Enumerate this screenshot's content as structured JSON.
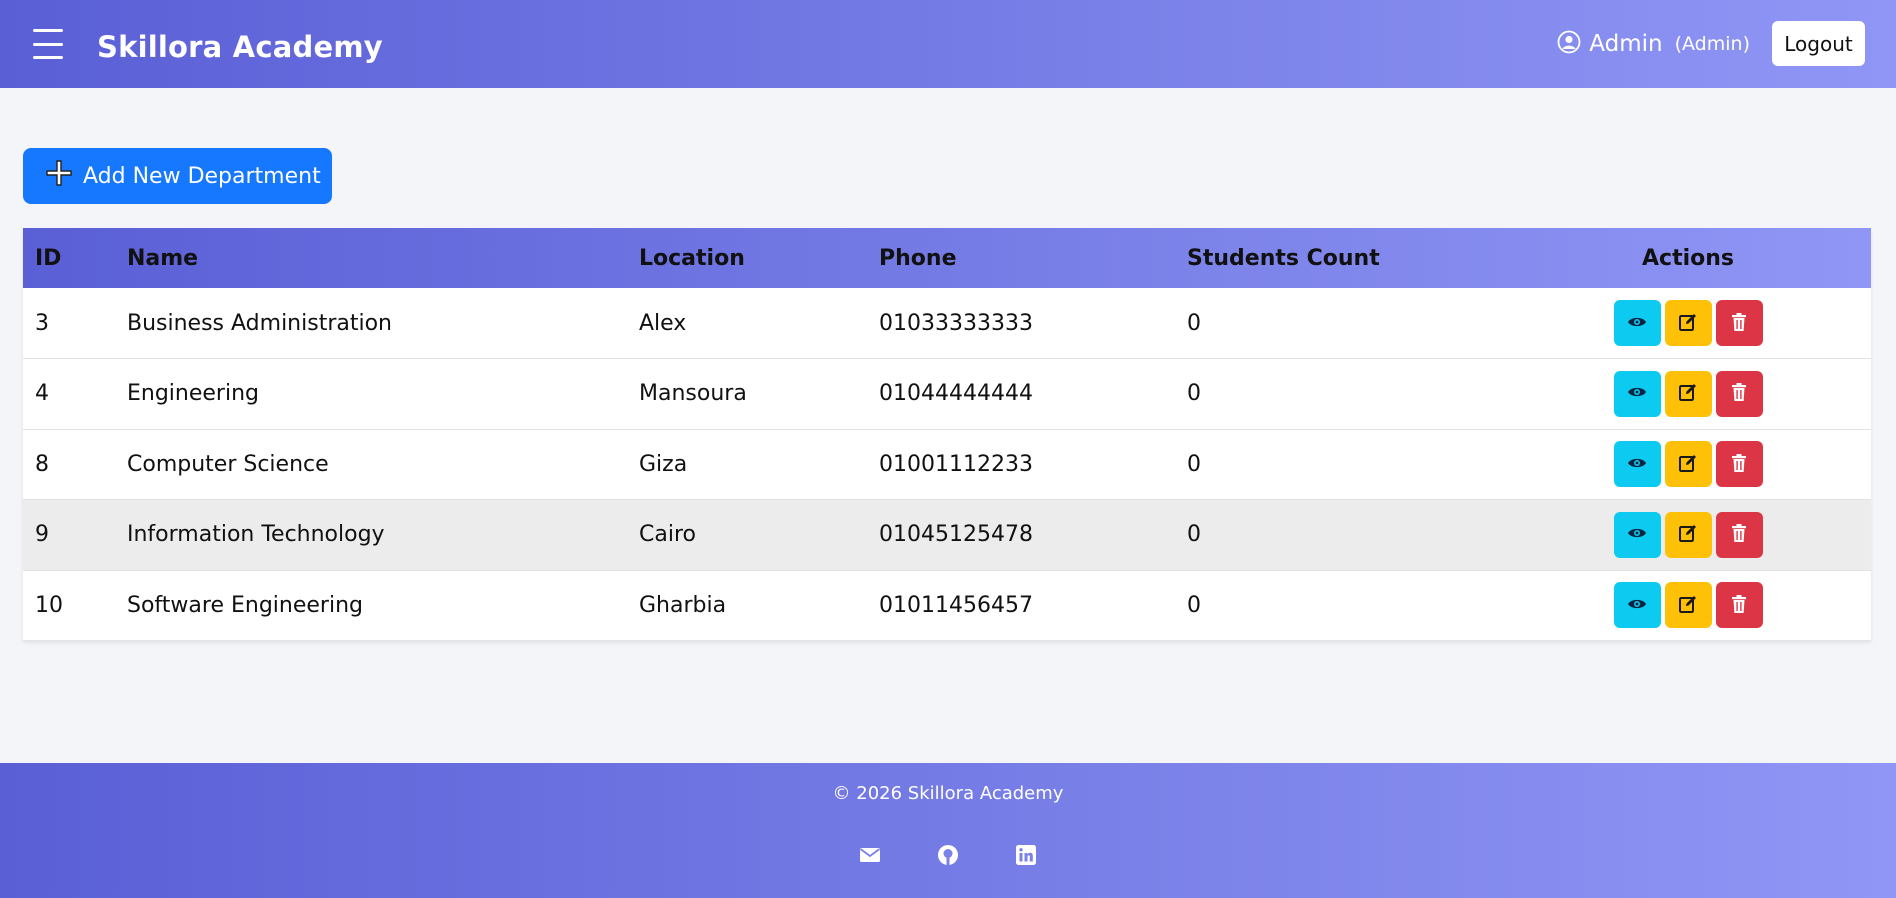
{
  "header": {
    "brand": "Skillora Academy",
    "user_name": "Admin",
    "user_role": "(Admin)",
    "logout_label": "Logout"
  },
  "toolbar": {
    "add_label": "Add New Department"
  },
  "table": {
    "columns": {
      "id": "ID",
      "name": "Name",
      "location": "Location",
      "phone": "Phone",
      "students": "Students Count",
      "actions": "Actions"
    },
    "rows": [
      {
        "id": "3",
        "name": "Business Administration",
        "location": "Alex",
        "phone": "01033333333",
        "students": "0"
      },
      {
        "id": "4",
        "name": "Engineering",
        "location": "Mansoura",
        "phone": "01044444444",
        "students": "0"
      },
      {
        "id": "8",
        "name": "Computer Science",
        "location": "Giza",
        "phone": "01001112233",
        "students": "0"
      },
      {
        "id": "9",
        "name": "Information Technology",
        "location": "Cairo",
        "phone": "01045125478",
        "students": "0"
      },
      {
        "id": "10",
        "name": "Software Engineering",
        "location": "Gharbia",
        "phone": "01011456457",
        "students": "0"
      }
    ]
  },
  "footer": {
    "copyright": "© 2026 Skillora Academy",
    "icons": [
      "envelope-icon",
      "github-icon",
      "linkedin-icon"
    ]
  },
  "colors": {
    "primary": "#1677ff",
    "view": "#0dcaf0",
    "edit": "#ffc107",
    "delete": "#dc3545",
    "gradient_start": "#5a5fd6",
    "gradient_end": "#9096f5"
  }
}
